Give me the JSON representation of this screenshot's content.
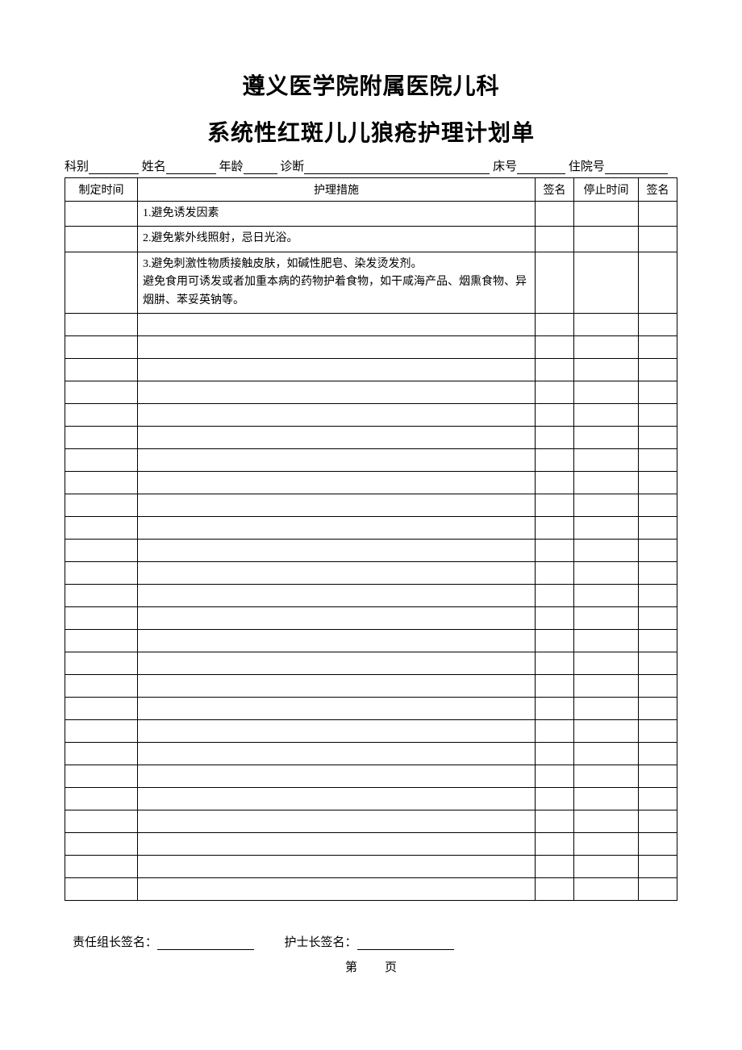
{
  "header": {
    "line1": "遵义医学院附属医院儿科",
    "line2": "系统性红斑儿儿狼疮护理计划单"
  },
  "patient_fields": {
    "dept_label": "科别",
    "name_label": "姓名",
    "age_label": "年龄",
    "diag_label": "诊断",
    "bed_label": "床号",
    "adm_label": "住院号"
  },
  "table": {
    "headers": {
      "time": "制定时间",
      "measure": "护理措施",
      "sign1": "签名",
      "stop": "停止时间",
      "sign2": "签名"
    },
    "rows": [
      {
        "measure": "1.避免诱发因素"
      },
      {
        "measure": "2.避免紫外线照射，忌日光浴。"
      },
      {
        "measure": "3.避免刺激性物质接触皮肤，如碱性肥皂、染发烫发剂。\n避免食用可诱发或者加重本病的药物护着食物，如干咸海产品、烟熏食物、异烟肼、苯妥英钠等。",
        "tall": true
      },
      {
        "measure": ""
      },
      {
        "measure": ""
      },
      {
        "measure": ""
      },
      {
        "measure": ""
      },
      {
        "measure": ""
      },
      {
        "measure": ""
      },
      {
        "measure": ""
      },
      {
        "measure": ""
      },
      {
        "measure": ""
      },
      {
        "measure": ""
      },
      {
        "measure": ""
      },
      {
        "measure": ""
      },
      {
        "measure": ""
      },
      {
        "measure": ""
      },
      {
        "measure": ""
      },
      {
        "measure": ""
      },
      {
        "measure": ""
      },
      {
        "measure": ""
      },
      {
        "measure": ""
      },
      {
        "measure": ""
      },
      {
        "measure": ""
      },
      {
        "measure": ""
      },
      {
        "measure": ""
      },
      {
        "measure": ""
      },
      {
        "measure": ""
      },
      {
        "measure": ""
      }
    ]
  },
  "footer": {
    "leader_label": "责任组长签名：",
    "nurse_label": "护士长签名：",
    "page_prefix": "第",
    "page_suffix": "页"
  }
}
